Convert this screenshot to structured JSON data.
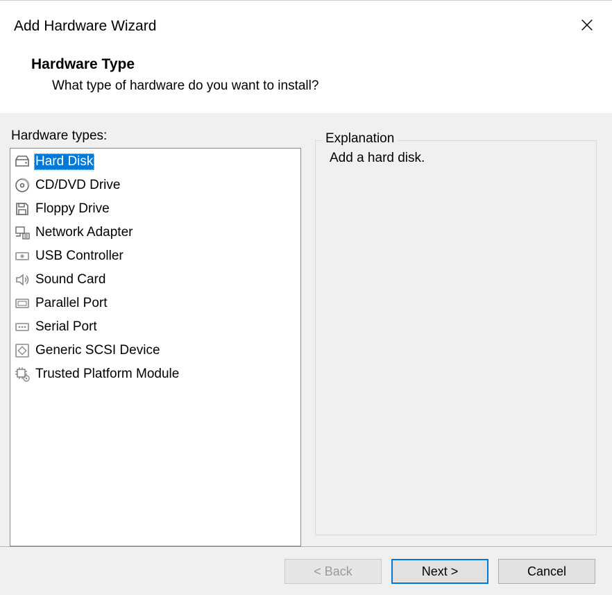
{
  "dialog": {
    "title": "Add Hardware Wizard",
    "heading": "Hardware Type",
    "subheading": "What type of hardware do you want to install?"
  },
  "list": {
    "label": "Hardware types:",
    "items": [
      {
        "label": "Hard Disk",
        "icon": "hard-disk-icon",
        "selected": true
      },
      {
        "label": "CD/DVD Drive",
        "icon": "cd-dvd-icon",
        "selected": false
      },
      {
        "label": "Floppy Drive",
        "icon": "floppy-icon",
        "selected": false
      },
      {
        "label": "Network Adapter",
        "icon": "network-adapter-icon",
        "selected": false
      },
      {
        "label": "USB Controller",
        "icon": "usb-icon",
        "selected": false
      },
      {
        "label": "Sound Card",
        "icon": "sound-card-icon",
        "selected": false
      },
      {
        "label": "Parallel Port",
        "icon": "parallel-port-icon",
        "selected": false
      },
      {
        "label": "Serial Port",
        "icon": "serial-port-icon",
        "selected": false
      },
      {
        "label": "Generic SCSI Device",
        "icon": "scsi-icon",
        "selected": false
      },
      {
        "label": "Trusted Platform Module",
        "icon": "tpm-icon",
        "selected": false
      }
    ]
  },
  "explanation": {
    "legend": "Explanation",
    "text": "Add a hard disk."
  },
  "footer": {
    "back": "< Back",
    "next": "Next >",
    "cancel": "Cancel"
  }
}
